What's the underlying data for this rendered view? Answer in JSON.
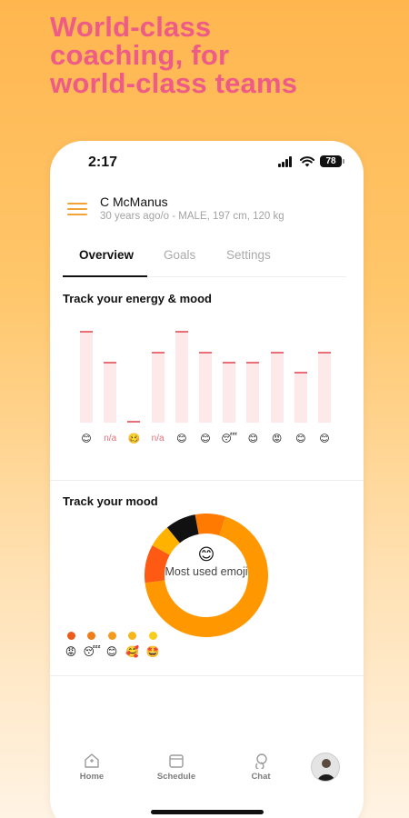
{
  "headline": {
    "lines": [
      "World-class",
      "coaching, for",
      "world-class teams"
    ]
  },
  "status_bar": {
    "time": "2:17",
    "battery": "78"
  },
  "profile": {
    "name": "C McManus",
    "info": "30 years ago/o - MALE, 197 cm, 120 kg"
  },
  "tabs": [
    {
      "label": "Overview",
      "active": true
    },
    {
      "label": "Goals",
      "active": false
    },
    {
      "label": "Settings",
      "active": false
    }
  ],
  "energy": {
    "title": "Track your energy & mood",
    "entries": [
      {
        "level": 0.9,
        "mood": "😊"
      },
      {
        "level": 0.6,
        "mood": "n/a"
      },
      {
        "level": 0.0,
        "mood": "🥴"
      },
      {
        "level": 0.7,
        "mood": "n/a"
      },
      {
        "level": 0.9,
        "mood": "😊"
      },
      {
        "level": 0.7,
        "mood": "😊"
      },
      {
        "level": 0.6,
        "mood": "😴"
      },
      {
        "level": 0.6,
        "mood": "😊"
      },
      {
        "level": 0.7,
        "mood": "😡"
      },
      {
        "level": 0.5,
        "mood": "😊"
      },
      {
        "level": 0.7,
        "mood": "😊"
      }
    ]
  },
  "mood": {
    "title": "Track your mood",
    "center_emoji": "😊",
    "center_label": "Most used emoji",
    "slices": [
      {
        "emoji": "😊",
        "share": 0.68,
        "color": "#ff9800"
      },
      {
        "emoji": "😡",
        "share": 0.1,
        "color": "#ff5a14"
      },
      {
        "emoji": "🥰",
        "share": 0.06,
        "color": "#ffb300"
      },
      {
        "emoji": "😴",
        "share": 0.08,
        "color": "#111111"
      },
      {
        "emoji": "🥴",
        "share": 0.08,
        "color": "#ff7a00"
      }
    ],
    "legend": [
      {
        "emoji": "😡",
        "color": "#ee5a1a"
      },
      {
        "emoji": "😴",
        "color": "#f07e18"
      },
      {
        "emoji": "😊",
        "color": "#f59a1e"
      },
      {
        "emoji": "🥰",
        "color": "#f7b61c"
      },
      {
        "emoji": "🤩",
        "color": "#f8cc1a"
      }
    ]
  },
  "nav": {
    "items": [
      {
        "label": "Home",
        "icon": "home-icon"
      },
      {
        "label": "Schedule",
        "icon": "calendar-icon"
      },
      {
        "label": "Chat",
        "icon": "chat-icon"
      }
    ],
    "avatar": "avatar"
  }
}
